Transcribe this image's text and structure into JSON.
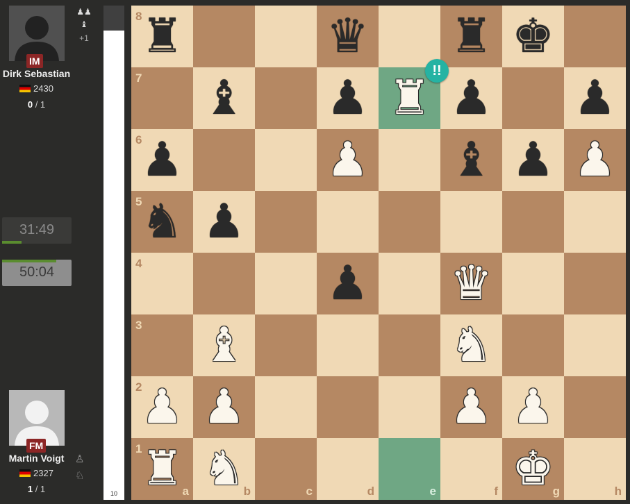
{
  "top_player": {
    "title": "IM",
    "name": "Dirk Sebastian",
    "rating": "2430",
    "score_won": "0",
    "score_total": "/ 1",
    "captured_icons": [
      "♟♟",
      "♝"
    ],
    "material_diff": "+1",
    "clock": "31:49",
    "clock_fraction": 0.28
  },
  "bottom_player": {
    "title": "FM",
    "name": "Martin Voigt",
    "rating": "2327",
    "score_won": "1",
    "score_total": "/ 1",
    "captured_icons": [
      "♙",
      "♘"
    ],
    "clock": "50:04",
    "clock_fraction": 0.78
  },
  "eval_bar": {
    "label": "10",
    "white_fraction": 0.95
  },
  "board": {
    "files": [
      "a",
      "b",
      "c",
      "d",
      "e",
      "f",
      "g",
      "h"
    ],
    "ranks": [
      "8",
      "7",
      "6",
      "5",
      "4",
      "3",
      "2",
      "1"
    ],
    "highlighted_squares": [
      "e7",
      "e1"
    ],
    "move_annotation": {
      "square": "e7",
      "label": "!!"
    },
    "pieces": [
      {
        "sq": "a8",
        "glyph": "♜",
        "color": "b"
      },
      {
        "sq": "d8",
        "glyph": "♛",
        "color": "b"
      },
      {
        "sq": "f8",
        "glyph": "♜",
        "color": "b"
      },
      {
        "sq": "g8",
        "glyph": "♚",
        "color": "b"
      },
      {
        "sq": "b7",
        "glyph": "♝",
        "color": "b"
      },
      {
        "sq": "d7",
        "glyph": "♟",
        "color": "b"
      },
      {
        "sq": "e7",
        "glyph": "♜",
        "color": "w"
      },
      {
        "sq": "f7",
        "glyph": "♟",
        "color": "b"
      },
      {
        "sq": "h7",
        "glyph": "♟",
        "color": "b"
      },
      {
        "sq": "a6",
        "glyph": "♟",
        "color": "b"
      },
      {
        "sq": "d6",
        "glyph": "♟",
        "color": "w"
      },
      {
        "sq": "f6",
        "glyph": "♝",
        "color": "b"
      },
      {
        "sq": "g6",
        "glyph": "♟",
        "color": "b"
      },
      {
        "sq": "h6",
        "glyph": "♟",
        "color": "w"
      },
      {
        "sq": "a5",
        "glyph": "♞",
        "color": "b"
      },
      {
        "sq": "b5",
        "glyph": "♟",
        "color": "b"
      },
      {
        "sq": "d4",
        "glyph": "♟",
        "color": "b"
      },
      {
        "sq": "f4",
        "glyph": "♛",
        "color": "w"
      },
      {
        "sq": "b3",
        "glyph": "♝",
        "color": "w"
      },
      {
        "sq": "f3",
        "glyph": "♞",
        "color": "w"
      },
      {
        "sq": "a2",
        "glyph": "♟",
        "color": "w"
      },
      {
        "sq": "b2",
        "glyph": "♟",
        "color": "w"
      },
      {
        "sq": "f2",
        "glyph": "♟",
        "color": "w"
      },
      {
        "sq": "g2",
        "glyph": "♟",
        "color": "w"
      },
      {
        "sq": "a1",
        "glyph": "♜",
        "color": "w"
      },
      {
        "sq": "b1",
        "glyph": "♞",
        "color": "w"
      },
      {
        "sq": "g1",
        "glyph": "♚",
        "color": "w"
      }
    ]
  },
  "colors": {
    "light_square": "#f0d9b5",
    "dark_square": "#b58863",
    "highlight": "#6fa784",
    "brilliant_badge": "#25b3a3",
    "title_badge": "#8c2626"
  }
}
